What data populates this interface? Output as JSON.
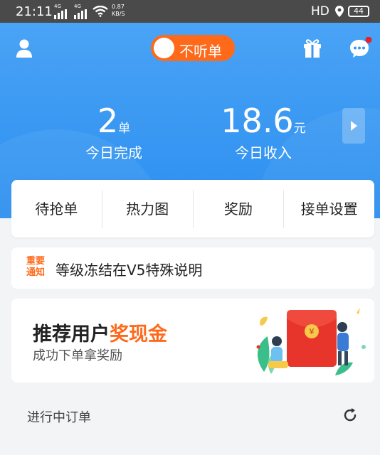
{
  "statusbar": {
    "time": "21:11",
    "net1": "4G",
    "net2": "4G",
    "speed_value": "0.87",
    "speed_unit": "KB/S",
    "hd": "HD",
    "battery": "44"
  },
  "header": {
    "toggle_label": "不听单",
    "stats": [
      {
        "value": "2",
        "unit": "单",
        "label": "今日完成"
      },
      {
        "value": "18.6",
        "unit": "元",
        "label": "今日收入"
      }
    ]
  },
  "menu": [
    {
      "label": "待抢单"
    },
    {
      "label": "热力图"
    },
    {
      "label": "奖励"
    },
    {
      "label": "接单设置"
    }
  ],
  "notice": {
    "tag_line1": "重要",
    "tag_line2": "通知",
    "text": "等级冻结在V5特殊说明"
  },
  "banner": {
    "title_part1": "推荐用户",
    "title_highlight": "奖现金",
    "subtitle": "成功下单拿奖励"
  },
  "orders": {
    "title": "进行中订单"
  },
  "colors": {
    "accent": "#ff6a1a",
    "header_blue": "#2c8ff0",
    "red_dot": "#e8202a"
  }
}
